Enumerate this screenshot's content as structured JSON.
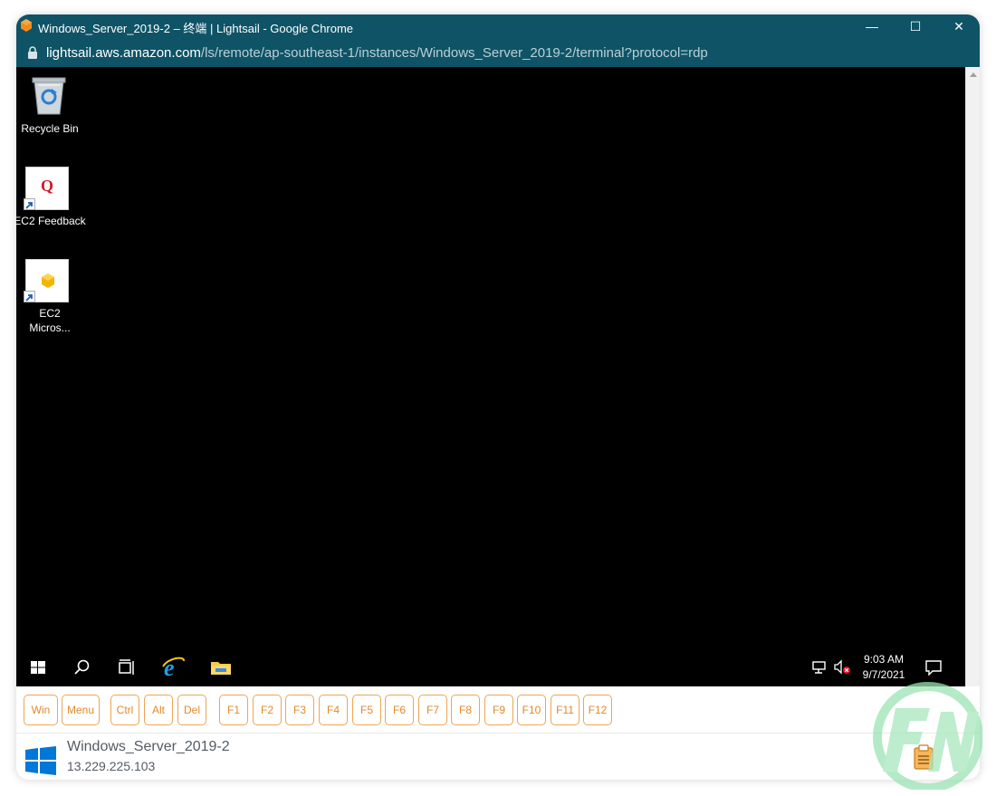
{
  "browser": {
    "title": "Windows_Server_2019-2 – 终端 | Lightsail - Google Chrome",
    "url_host": "lightsail.aws.amazon.com",
    "url_path": "/ls/remote/ap-southeast-1/instances/Windows_Server_2019-2/terminal?protocol=rdp",
    "controls": {
      "minimize": "—",
      "maximize": "☐",
      "close": "✕"
    }
  },
  "desktop": {
    "icons": [
      {
        "label": "Recycle Bin",
        "icon": "recycle-bin-icon"
      },
      {
        "label": "EC2 Feedback",
        "icon": "ec2-feedback-icon",
        "glyph": "Q"
      },
      {
        "label": "EC2\nMicros...",
        "icon": "ec2-microsoft-icon"
      }
    ]
  },
  "taskbar": {
    "items": [
      "start-icon",
      "search-icon",
      "task-view-icon",
      "internet-explorer-icon",
      "file-explorer-icon"
    ],
    "tray": {
      "time": "9:03 AM",
      "date": "9/7/2021"
    }
  },
  "keys": {
    "group1": [
      "Win",
      "Menu"
    ],
    "group2": [
      "Ctrl",
      "Alt",
      "Del"
    ],
    "group3": [
      "F1",
      "F2",
      "F3",
      "F4",
      "F5",
      "F6",
      "F7",
      "F8",
      "F9",
      "F10",
      "F11",
      "F12"
    ]
  },
  "instance": {
    "name": "Windows_Server_2019-2",
    "ip": "13.229.225.103"
  },
  "colors": {
    "chrome_bar": "#0f5366",
    "key_accent": "#f0a552",
    "windows_blue": "#0078d7"
  }
}
